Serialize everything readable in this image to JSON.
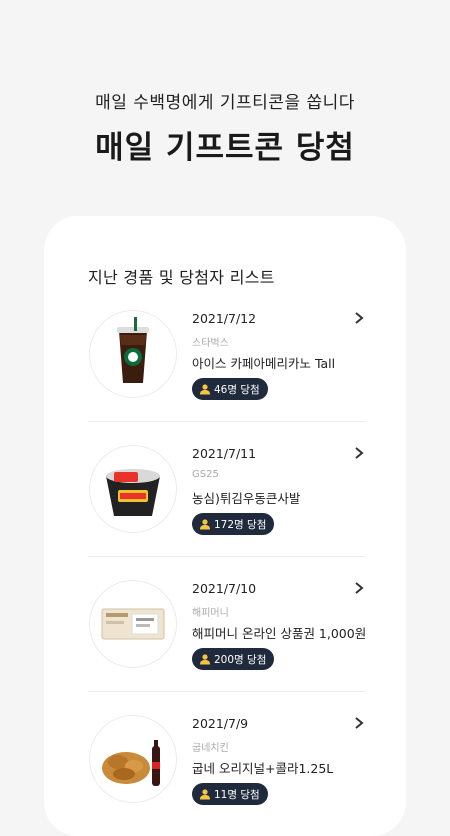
{
  "hero": {
    "subtitle": "매일 수백명에게 기프티콘을 쏩니다",
    "title": "매일 기프트콘 당첨"
  },
  "list": {
    "title": "지난 경품 및 당첨자 리스트",
    "items": [
      {
        "date": "2021/7/12",
        "brand": "스타벅스",
        "product": "아이스 카페아메리카노 Tall",
        "winners": "46명 당첨",
        "icon": "iced-coffee-image"
      },
      {
        "date": "2021/7/11",
        "brand": "GS25",
        "product": "농심)튀김우동큰사발",
        "winners": "172명 당첨",
        "icon": "cup-noodle-image"
      },
      {
        "date": "2021/7/10",
        "brand": "해피머니",
        "product": "해피머니 온라인 상품권 1,000원",
        "winners": "200명 당첨",
        "icon": "gift-card-image"
      },
      {
        "date": "2021/7/9",
        "brand": "굽네치킨",
        "product": "굽네 오리지널+콜라1.25L",
        "winners": "11명 당첨",
        "icon": "chicken-cola-image"
      }
    ]
  },
  "colors": {
    "badge_bg": "#1f2a3d",
    "badge_icon": "#f5c542",
    "card_bg": "#ffffff",
    "page_bg": "#f5f5f6"
  }
}
